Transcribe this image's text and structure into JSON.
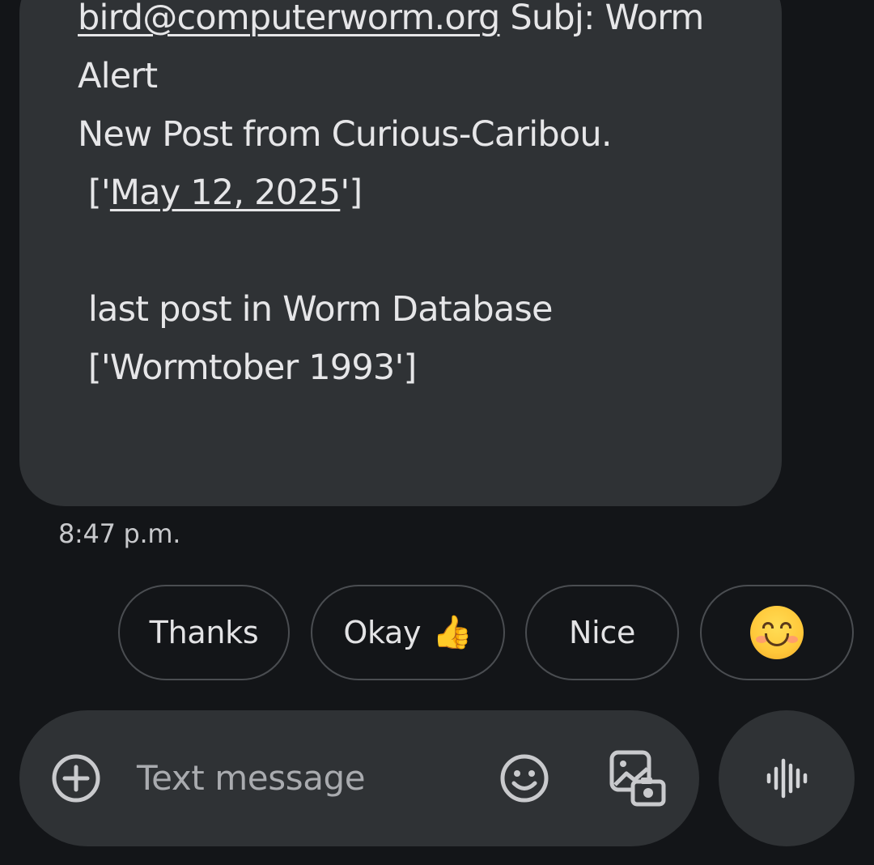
{
  "message": {
    "email": "bird@computerworm.org",
    "subject_suffix": " Subj: Worm",
    "line2": "Alert",
    "line3": "New Post from Curious-Caribou.",
    "line4_prefix": " ['",
    "date_link": "May 12, 2025",
    "line4_suffix": "']",
    "line6": " last post in Worm Database",
    "line7": " ['Wormtober 1993']",
    "timestamp": "8:47 p.m."
  },
  "smart_replies": [
    {
      "label": "Thanks"
    },
    {
      "label": "Okay",
      "emoji": "👍"
    },
    {
      "label": "Nice"
    },
    {
      "label": "",
      "icon": "smiling-face-emoji"
    }
  ],
  "composer": {
    "placeholder": "Text message",
    "icons": [
      "add-circle-icon",
      "emoji-icon",
      "gallery-icon",
      "voice-waveform-icon"
    ]
  },
  "colors": {
    "background": "#131518",
    "bubble": "#2f3235",
    "chip_border": "#4a4d51",
    "text": "#e6e6e8"
  }
}
